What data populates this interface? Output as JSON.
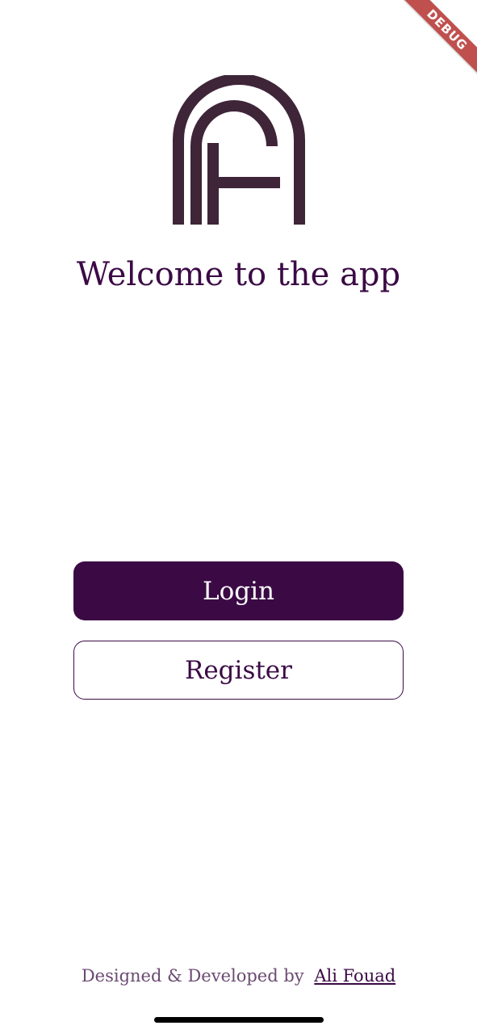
{
  "debug_banner": {
    "label": "DEBUG"
  },
  "welcome": {
    "title": "Welcome to the app"
  },
  "actions": {
    "login_label": "Login",
    "register_label": "Register"
  },
  "footer": {
    "credit_prefix": "Designed & Developed by",
    "author_name": "Ali Fouad"
  },
  "colors": {
    "primary": "#3b0a45",
    "logo": "#3f2538",
    "background": "#ffffff",
    "debug_banner": "#c0504d"
  },
  "icons": {
    "logo": "af-arch-logo-icon"
  }
}
